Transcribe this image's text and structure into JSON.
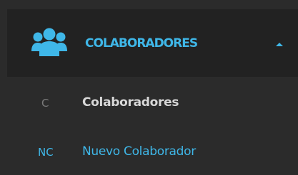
{
  "menu": {
    "group": {
      "label": "COLABORADORES",
      "icon": "users-group-icon",
      "expanded": true,
      "caret_icon": "caret-up-icon",
      "accent_color": "#3fb7e8"
    },
    "items": [
      {
        "abbr": "C",
        "label": "Colaboradores",
        "active": true
      },
      {
        "abbr": "NC",
        "label": "Nuevo Colaborador",
        "active": false
      }
    ]
  },
  "colors": {
    "background": "#2b2b2b",
    "header_background": "#222222",
    "accent": "#3fb7e8",
    "active_text": "#d8d8d8",
    "muted_text": "#7a7a7a"
  }
}
